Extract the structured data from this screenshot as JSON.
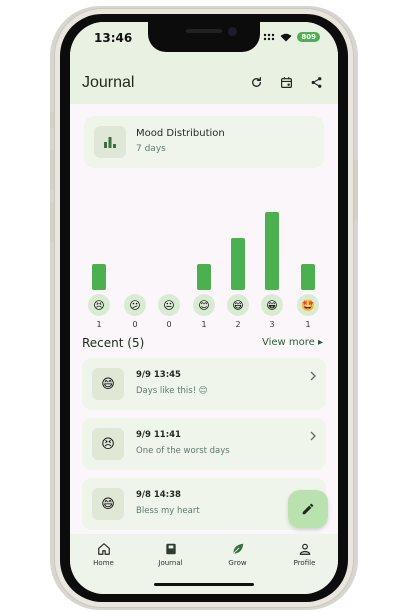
{
  "status_bar": {
    "time": "13:46",
    "battery": "809"
  },
  "header": {
    "title": "Journal"
  },
  "mood_card": {
    "title": "Mood Distribution",
    "period": "7 days"
  },
  "chart_data": {
    "type": "bar",
    "categories": [
      "😣",
      "😕",
      "😐",
      "😊",
      "😄",
      "😁",
      "🤩"
    ],
    "values": [
      1,
      0,
      0,
      1,
      2,
      3,
      1
    ],
    "ylim": [
      0,
      3
    ],
    "bar_color": "#4caf50"
  },
  "recent": {
    "title": "Recent (5)",
    "view_more": "View more ▸",
    "entries": [
      {
        "date": "9/9 13:45",
        "text": "Days like this! 😊",
        "mood": "😄"
      },
      {
        "date": "9/9 11:41",
        "text": "One of the worst days",
        "mood": "😣"
      },
      {
        "date": "9/8 14:38",
        "text": "Bless my heart",
        "mood": "😄"
      }
    ]
  },
  "nav": {
    "items": [
      {
        "label": "Home",
        "icon": "home-icon"
      },
      {
        "label": "Journal",
        "icon": "book-icon"
      },
      {
        "label": "Grow",
        "icon": "leaf-icon"
      },
      {
        "label": "Profile",
        "icon": "person-icon"
      }
    ],
    "active": "Journal"
  },
  "colors": {
    "accent": "#4caf50",
    "header_bg": "#e9f1e3",
    "card_bg": "#f0f5ec",
    "fab": "#b9e2ae"
  }
}
